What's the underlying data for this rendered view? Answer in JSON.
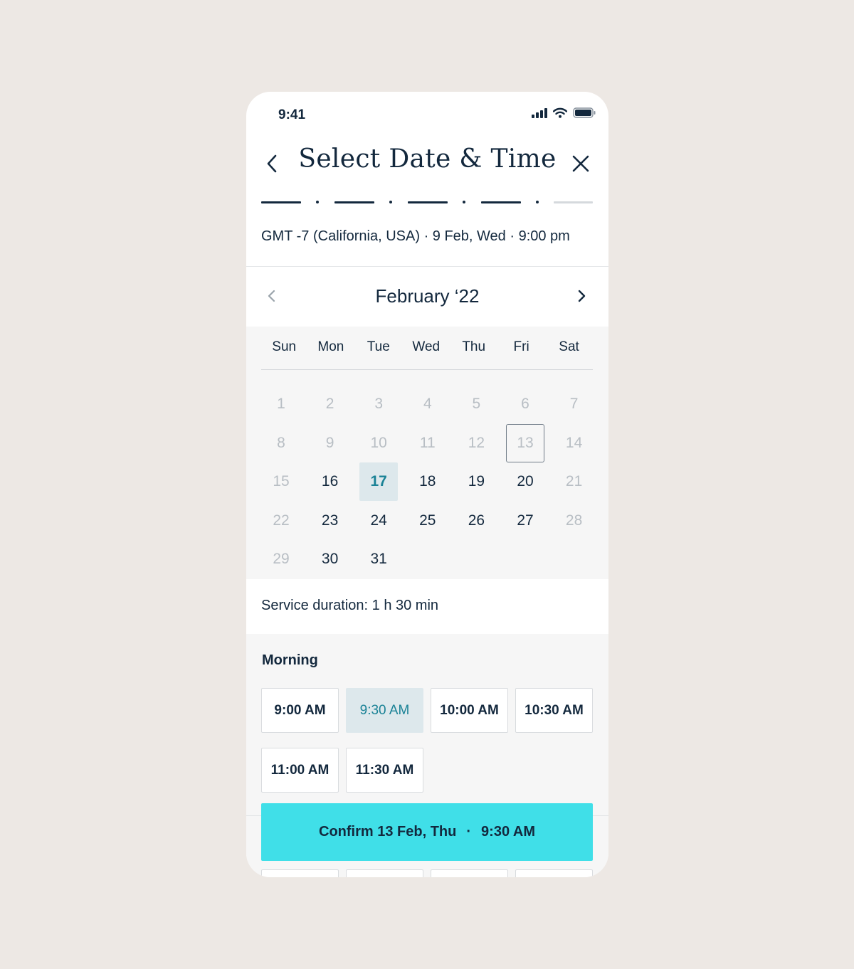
{
  "status_bar": {
    "time": "9:41"
  },
  "header": {
    "title": "Select Date & Time"
  },
  "timezone_line": "GMT -7 (California, USA) · 9 Feb, Wed · 9:00 pm",
  "calendar": {
    "month_label": "February ‘22",
    "weekdays": [
      "Sun",
      "Mon",
      "Tue",
      "Wed",
      "Thu",
      "Fri",
      "Sat"
    ],
    "weeks": [
      [
        {
          "d": "1",
          "s": "disabled"
        },
        {
          "d": "2",
          "s": "disabled"
        },
        {
          "d": "3",
          "s": "disabled"
        },
        {
          "d": "4",
          "s": "disabled"
        },
        {
          "d": "5",
          "s": "disabled"
        },
        {
          "d": "6",
          "s": "disabled"
        },
        {
          "d": "7",
          "s": "disabled"
        }
      ],
      [
        {
          "d": "8",
          "s": "disabled"
        },
        {
          "d": "9",
          "s": "disabled"
        },
        {
          "d": "10",
          "s": "disabled"
        },
        {
          "d": "11",
          "s": "disabled"
        },
        {
          "d": "12",
          "s": "disabled"
        },
        {
          "d": "13",
          "s": "disabled today"
        },
        {
          "d": "14",
          "s": "disabled"
        }
      ],
      [
        {
          "d": "15",
          "s": "disabled"
        },
        {
          "d": "16",
          "s": ""
        },
        {
          "d": "17",
          "s": "selected"
        },
        {
          "d": "18",
          "s": ""
        },
        {
          "d": "19",
          "s": ""
        },
        {
          "d": "20",
          "s": ""
        },
        {
          "d": "21",
          "s": "disabled"
        }
      ],
      [
        {
          "d": "22",
          "s": "disabled"
        },
        {
          "d": "23",
          "s": ""
        },
        {
          "d": "24",
          "s": ""
        },
        {
          "d": "25",
          "s": ""
        },
        {
          "d": "26",
          "s": ""
        },
        {
          "d": "27",
          "s": ""
        },
        {
          "d": "28",
          "s": "disabled"
        }
      ],
      [
        {
          "d": "29",
          "s": "disabled"
        },
        {
          "d": "30",
          "s": ""
        },
        {
          "d": "31",
          "s": ""
        }
      ]
    ]
  },
  "service_duration": "Service duration: 1 h 30 min",
  "slots": {
    "heading": "Morning",
    "items": [
      {
        "label": "9:00 AM",
        "selected": false
      },
      {
        "label": "9:30 AM",
        "selected": true
      },
      {
        "label": "10:00 AM",
        "selected": false
      },
      {
        "label": "10:30 AM",
        "selected": false
      },
      {
        "label": "11:00 AM",
        "selected": false
      },
      {
        "label": "11:30 AM",
        "selected": false
      }
    ]
  },
  "confirm": {
    "date": "Confirm 13 Feb, Thu",
    "separator": "·",
    "time": "9:30 AM"
  },
  "colors": {
    "background": "#ede8e4",
    "text": "#13283d",
    "accent_button": "#40dfe8",
    "selected_fill": "#dde8ec",
    "selected_text": "#1a8296"
  }
}
